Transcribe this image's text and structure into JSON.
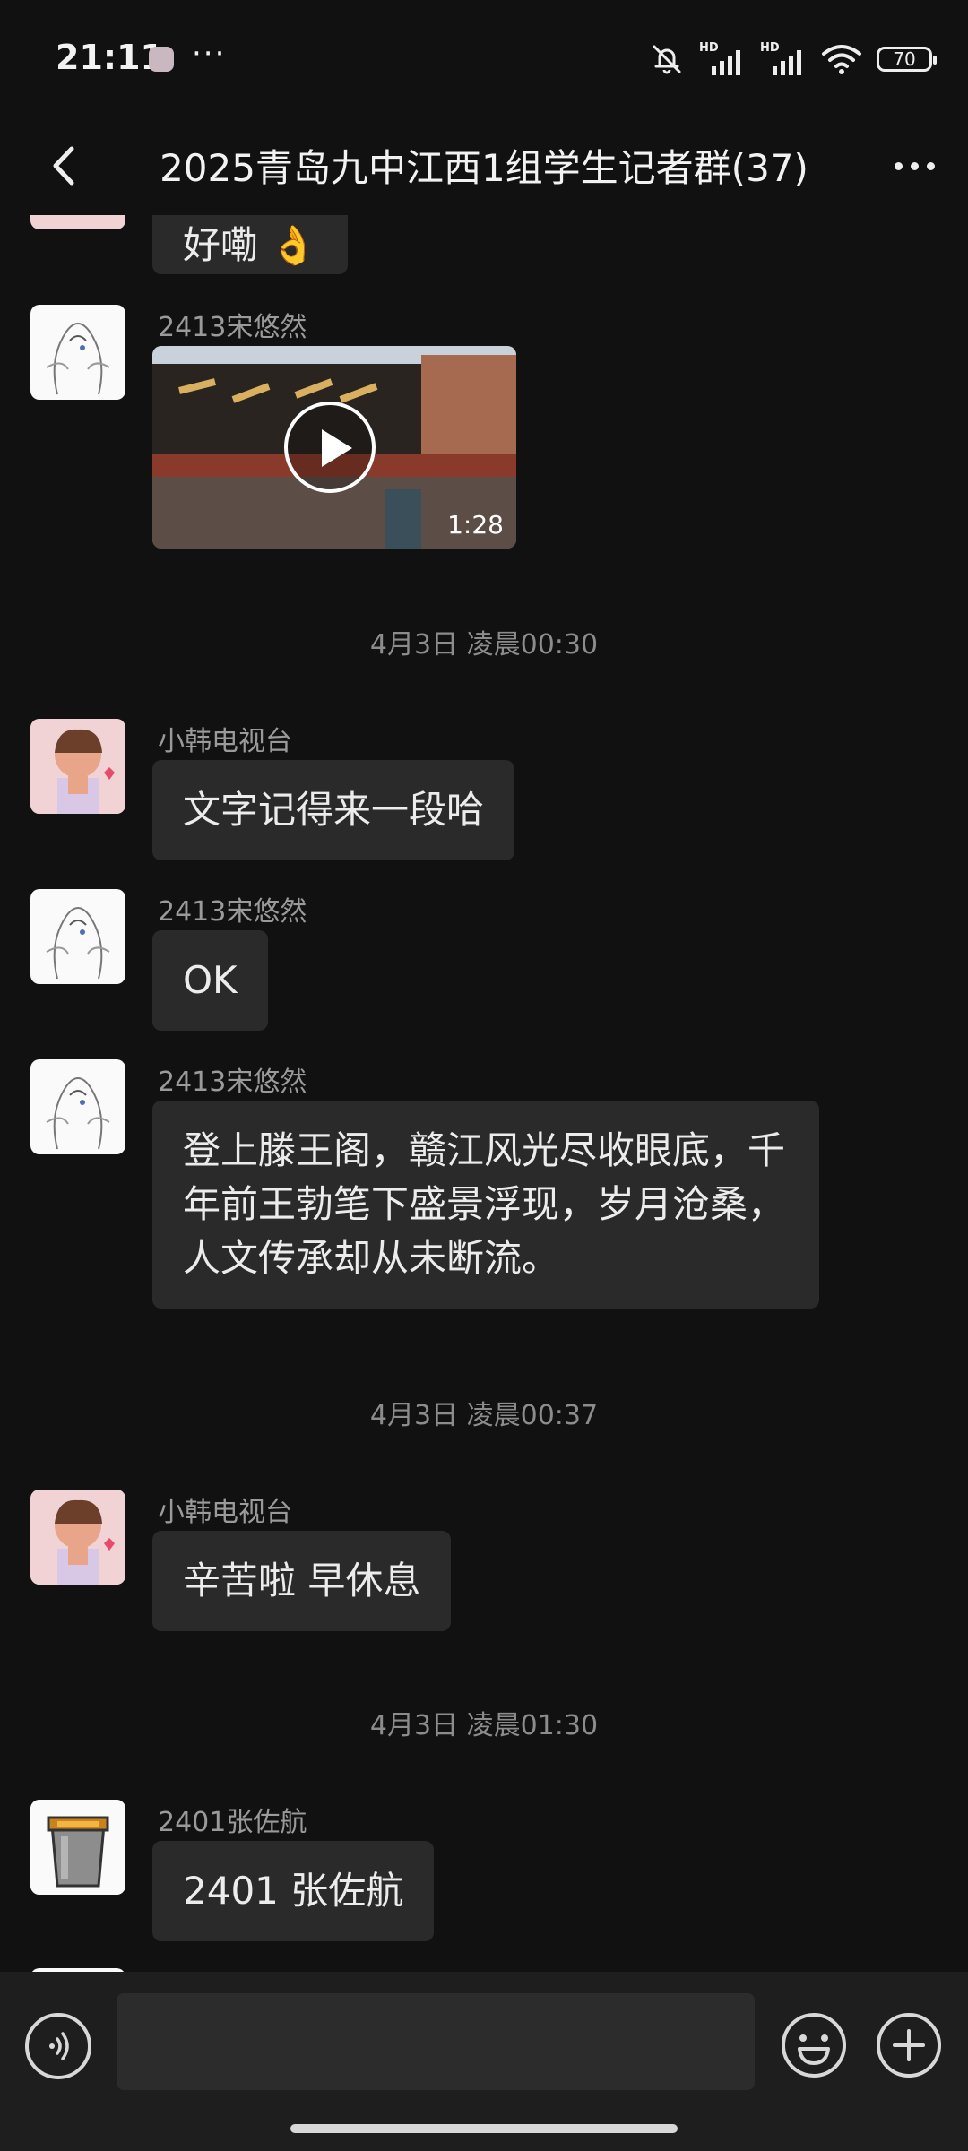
{
  "status_bar": {
    "time": "21:11",
    "more": "···",
    "hd1": "HD",
    "hd2": "HD",
    "battery": "70",
    "icons": [
      "notifications-muted-icon",
      "signal-icon",
      "signal-icon",
      "wifi-icon",
      "battery-icon"
    ]
  },
  "header": {
    "title": "2025青岛九中江西1组学生记者群(37)",
    "back_icon": "chevron-left-icon",
    "menu_icon": "more-horizontal-icon"
  },
  "messages": {
    "m0": {
      "text": "好嘞 👌"
    },
    "m1": {
      "sender": "2413宋悠然",
      "video_duration": "1:28"
    },
    "ts1": "4月3日 凌晨00:30",
    "m2": {
      "sender": "小韩电视台",
      "text": "文字记得来一段哈"
    },
    "m3": {
      "sender": "2413宋悠然",
      "text": "OK"
    },
    "m4": {
      "sender": "2413宋悠然",
      "text": "登上滕王阁，赣江风光尽收眼底，千年前王勃笔下盛景浮现，岁月沧桑，人文传承却从未断流。"
    },
    "ts2": "4月3日 凌晨00:37",
    "m5": {
      "sender": "小韩电视台",
      "text": "辛苦啦 早休息"
    },
    "ts3": "4月3日 凌晨01:30",
    "m6": {
      "sender": "2401张佐航",
      "text": "2401 张佐航"
    }
  },
  "input_bar": {
    "placeholder": "",
    "icons": [
      "voice-icon",
      "emoji-icon",
      "plus-icon"
    ]
  },
  "colors": {
    "background": "#111111",
    "bubble": "#2a2a2a",
    "input_bar": "#1e1e1e"
  }
}
